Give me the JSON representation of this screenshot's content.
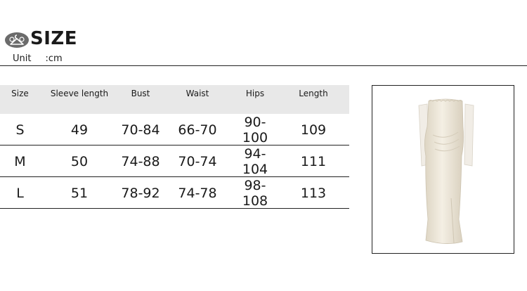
{
  "header": {
    "logo_icon": "hanger-icon",
    "title": "SIZE",
    "unit_label": "Unit",
    "unit_value": ":cm"
  },
  "size_table": {
    "columns": [
      "Size",
      "Sleeve length",
      "Bust",
      "Waist",
      "Hips",
      "Length"
    ],
    "rows": [
      [
        "S",
        "49",
        "70-84",
        "66-70",
        "90-100",
        "109"
      ],
      [
        "M",
        "50",
        "74-88",
        "70-74",
        "94-104",
        "111"
      ],
      [
        "L",
        "51",
        "78-92",
        "74-78",
        "98-108",
        "113"
      ]
    ]
  },
  "product_image": {
    "icon": "off-shoulder-dress-image",
    "dress_color": "#ece6d8"
  }
}
